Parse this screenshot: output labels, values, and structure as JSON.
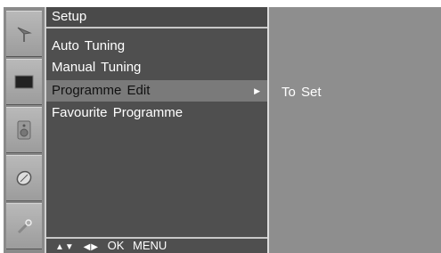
{
  "menu": {
    "title": "Setup",
    "items": [
      {
        "label": "Auto  Tuning"
      },
      {
        "label": "Manual  Tuning"
      },
      {
        "label": "Programme  Edit",
        "selected": true,
        "has_submenu": true
      },
      {
        "label": "Favourite  Programme"
      }
    ],
    "submenu_arrow": "▶",
    "footer": {
      "nav_keys": "▲▼ ◀▶",
      "ok": "OK",
      "menu": "MENU"
    }
  },
  "submenu": {
    "items": [
      {
        "label": "To Set"
      }
    ]
  },
  "icons": [
    "antenna-icon",
    "picture-icon",
    "speaker-icon",
    "time-icon",
    "tools-icon"
  ],
  "colors": {
    "menu_bg": "#4f4f4f",
    "selected_bg": "#7a7a7a",
    "subpanel_bg": "#8e8e8e",
    "icon_column": "#8a8a8a"
  }
}
